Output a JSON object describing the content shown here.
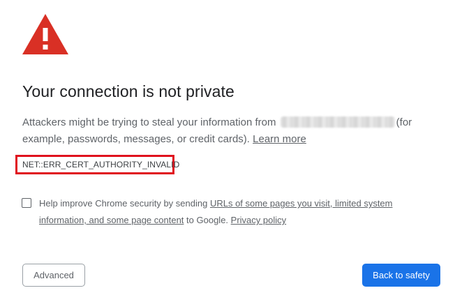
{
  "icon": "warning-triangle-icon",
  "colors": {
    "warning_red": "#d93025",
    "highlight_red": "#e0121e",
    "primary_blue": "#1a73e8",
    "body_text": "#5f6368",
    "heading_text": "#202124"
  },
  "heading": "Your connection is not private",
  "description": {
    "before_host": "Attackers might be trying to steal your information from",
    "after_host": "(for example, passwords, messages, or credit cards).",
    "learn_more": "Learn more"
  },
  "error_code": "NET::ERR_CERT_AUTHORITY_INVALID",
  "optin": {
    "checked": false,
    "text_before": "Help improve Chrome security by sending",
    "link_data": "URLs of some pages you visit, limited system information, and some page content",
    "text_middle": "to Google.",
    "link_privacy": "Privacy policy"
  },
  "buttons": {
    "advanced": "Advanced",
    "back_to_safety": "Back to safety"
  }
}
